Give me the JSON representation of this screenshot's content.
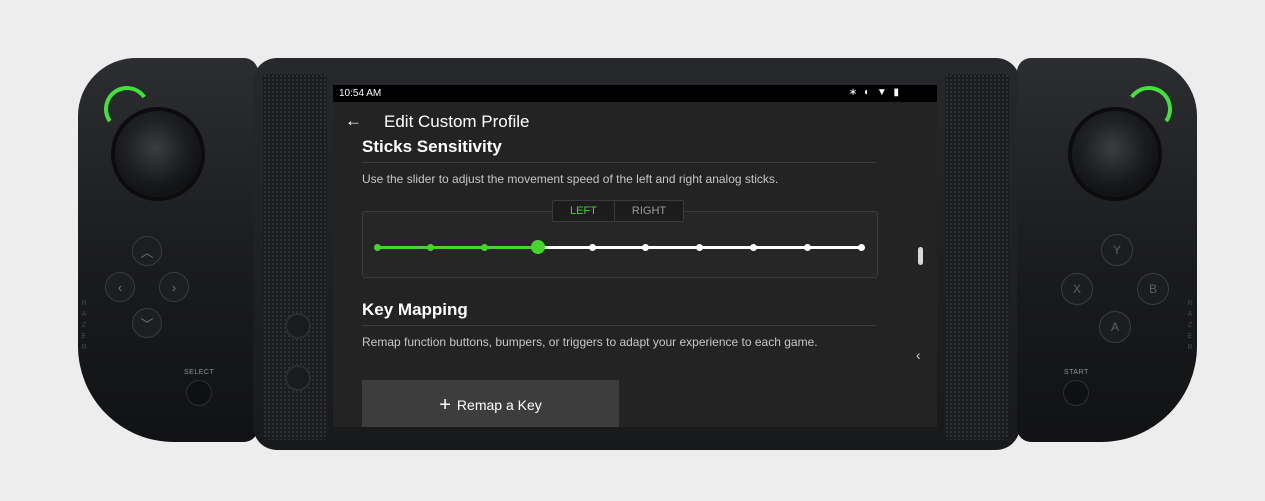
{
  "status_bar": {
    "time": "10:54 AM",
    "icons": "∗ ◐ ▼ ▮"
  },
  "app_bar": {
    "back_icon": "←",
    "title": "Edit Custom Profile"
  },
  "sticks_sensitivity": {
    "title": "Sticks Sensitivity",
    "description": "Use the slider to adjust the movement speed of the left and right analog sticks.",
    "tabs": [
      {
        "label": "LEFT",
        "active": true
      },
      {
        "label": "RIGHT",
        "active": false
      }
    ],
    "slider": {
      "steps": 10,
      "selected_step": 4
    }
  },
  "key_mapping": {
    "title": "Key Mapping",
    "description": "Remap function buttons, bumpers, or triggers to adapt your experience to each game.",
    "remap_button": {
      "icon": "+",
      "label": "Remap a Key"
    }
  },
  "nav": {
    "collapse_icon": "‹"
  },
  "controller": {
    "select_label": "SELECT",
    "start_label": "START",
    "brand_left": "RAZER",
    "brand_right": "RAZER",
    "face_buttons": {
      "top": "Y",
      "left": "X",
      "right": "B",
      "bottom": "A"
    },
    "dpad": {
      "up": "︿",
      "left": "‹",
      "right": "›",
      "down": "﹀"
    },
    "led_color": "#41e23a"
  },
  "colors": {
    "accent": "#44d62c"
  }
}
